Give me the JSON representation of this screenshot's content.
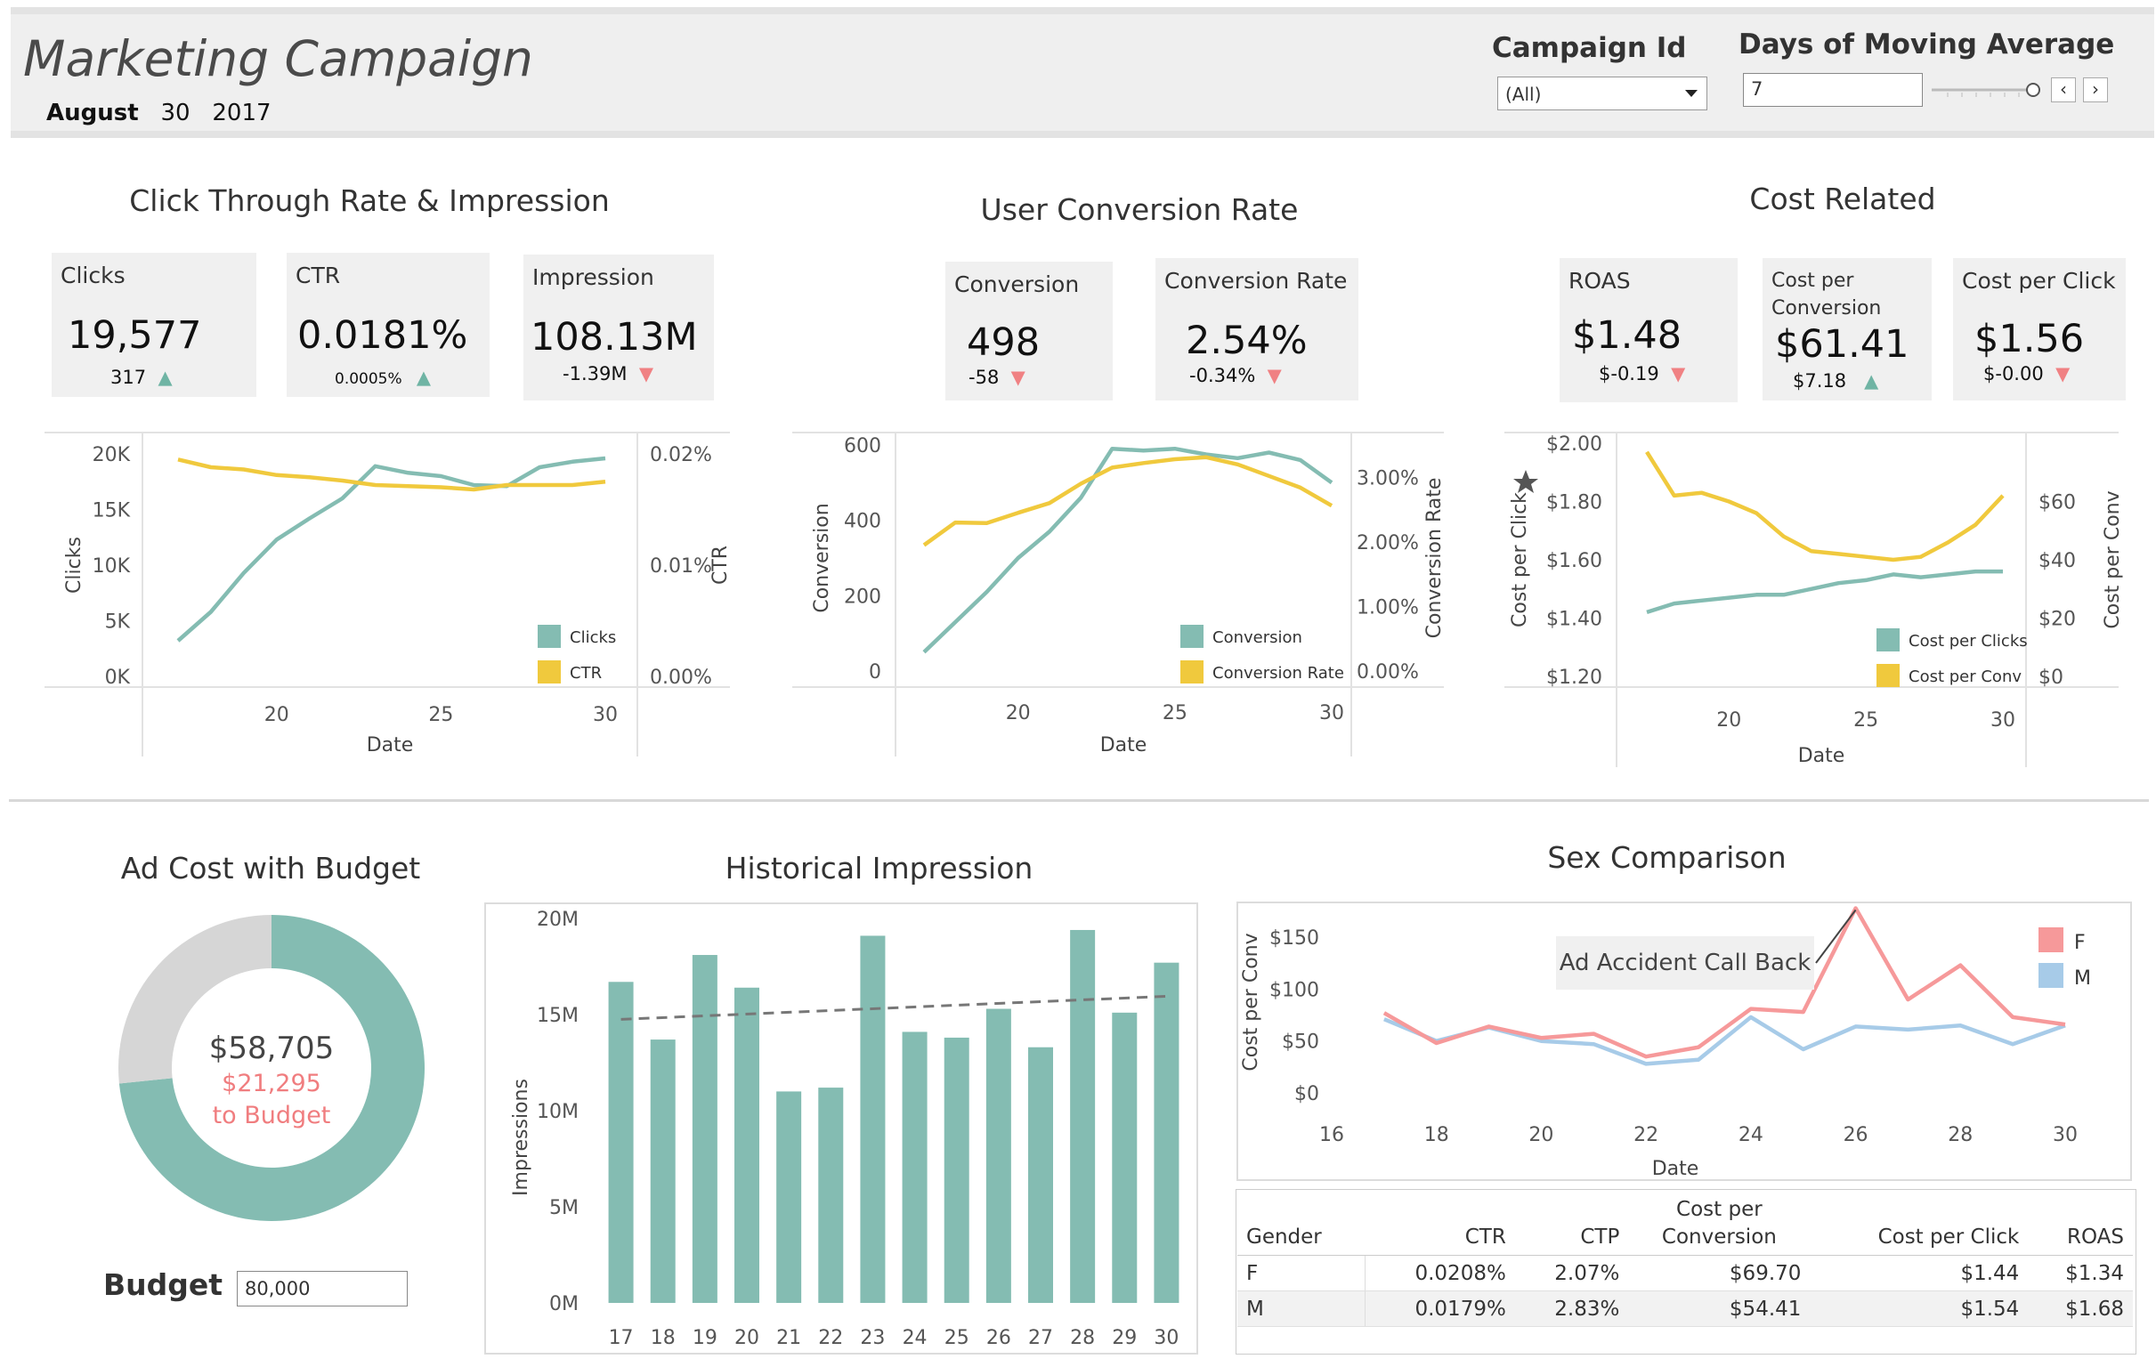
{
  "header": {
    "title": "Marketing Campaign",
    "date_month": "August",
    "date_day": "30",
    "date_year": "2017",
    "campaign_label": "Campaign Id",
    "campaign_value": "(All)",
    "days_label": "Days of Moving Average",
    "days_value": "7",
    "prev_glyph": "‹",
    "next_glyph": "›"
  },
  "colors": {
    "teal": "#84bcb2",
    "yellow": "#f0c93d",
    "pink": "#f6999a",
    "blue": "#a7cbe8",
    "up": "#6fb4a4",
    "down": "#f08183"
  },
  "sections": {
    "ctr": {
      "title": "Click Through Rate & Impression",
      "kpis": [
        {
          "label": "Clicks",
          "value": "19,577",
          "delta": "317",
          "dir": "up"
        },
        {
          "label": "CTR",
          "value": "0.0181%",
          "delta": "0.0005%",
          "dir": "up"
        },
        {
          "label": "Impression",
          "value": "108.13M",
          "delta": "-1.39M",
          "dir": "down"
        }
      ]
    },
    "conv": {
      "title": "User Conversion Rate",
      "kpis": [
        {
          "label": "Conversion",
          "value": "498",
          "delta": "-58",
          "dir": "down"
        },
        {
          "label": "Conversion Rate",
          "value": "2.54%",
          "delta": "-0.34%",
          "dir": "down"
        }
      ]
    },
    "cost": {
      "title": "Cost Related",
      "kpis": [
        {
          "label": "ROAS",
          "value": "$1.48",
          "delta": "$-0.19",
          "dir": "down"
        },
        {
          "label": "Cost per\nConversion",
          "value": "$61.41",
          "delta": "$7.18",
          "dir": "up"
        },
        {
          "label": "Cost per Click",
          "value": "$1.56",
          "delta": "$-0.00",
          "dir": "down"
        }
      ]
    },
    "budget": {
      "title": "Ad Cost with Budget",
      "spent": "$58,705",
      "remaining": "$21,295",
      "remaining_caption": "to Budget",
      "budget_label": "Budget",
      "budget_value": "80,000"
    },
    "historical": {
      "title": "Historical Impression"
    },
    "sex": {
      "title": "Sex Comparison",
      "annotation": "Ad Accident Call Back",
      "table": {
        "headers": [
          "Gender",
          "CTR",
          "CTP",
          "Cost per\nConversion",
          "Cost per Click",
          "ROAS"
        ],
        "rows": [
          [
            "F",
            "0.0208%",
            "2.07%",
            "$69.70",
            "$1.44",
            "$1.34"
          ],
          [
            "M",
            "0.0179%",
            "2.83%",
            "$54.41",
            "$1.54",
            "$1.68"
          ]
        ]
      }
    }
  },
  "chart_data": [
    {
      "id": "ctr_chart",
      "type": "line",
      "x": [
        17,
        18,
        19,
        20,
        21,
        22,
        23,
        24,
        25,
        26,
        27,
        28,
        29,
        30
      ],
      "xlabel": "Date",
      "x_ticks": [
        20,
        25,
        30
      ],
      "y_left": {
        "label": "Clicks",
        "ylim": [
          0,
          20000
        ],
        "ticks": [
          0,
          5000,
          10000,
          15000,
          20000
        ],
        "tick_labels": [
          "0K",
          "5K",
          "10K",
          "15K",
          "20K"
        ]
      },
      "y_right": {
        "label": "CTR",
        "ylim": [
          0,
          0.02
        ],
        "ticks": [
          0,
          0.01,
          0.02
        ],
        "tick_labels": [
          "0.00%",
          "0.01%",
          "0.02%"
        ]
      },
      "series": [
        {
          "name": "Clicks",
          "axis": "left",
          "color": "#84bcb2",
          "values": [
            3200,
            5800,
            9300,
            12300,
            14200,
            16000,
            18900,
            18300,
            18000,
            17200,
            17100,
            18800,
            19300,
            19600
          ]
        },
        {
          "name": "CTR",
          "axis": "right",
          "color": "#f0c93d",
          "values": [
            0.0195,
            0.0188,
            0.0186,
            0.0181,
            0.0179,
            0.0176,
            0.0172,
            0.0171,
            0.017,
            0.0168,
            0.0172,
            0.0172,
            0.0172,
            0.0175
          ]
        }
      ],
      "legend": "bottom-right"
    },
    {
      "id": "conv_chart",
      "type": "line",
      "x": [
        17,
        18,
        19,
        20,
        21,
        22,
        23,
        24,
        25,
        26,
        27,
        28,
        29,
        30
      ],
      "xlabel": "Date",
      "x_ticks": [
        20,
        25,
        30
      ],
      "y_left": {
        "label": "Conversion",
        "ylim": [
          0,
          600
        ],
        "ticks": [
          0,
          200,
          400,
          600
        ],
        "tick_labels": [
          "0",
          "200",
          "400",
          "600"
        ]
      },
      "y_right": {
        "label": "Conversion Rate",
        "ylim": [
          0,
          3.5
        ],
        "ticks": [
          0,
          1,
          2,
          3
        ],
        "tick_labels": [
          "0.00%",
          "1.00%",
          "2.00%",
          "3.00%"
        ]
      },
      "series": [
        {
          "name": "Conversion",
          "axis": "left",
          "color": "#84bcb2",
          "values": [
            50,
            130,
            210,
            300,
            370,
            460,
            590,
            585,
            590,
            575,
            565,
            580,
            560,
            500
          ]
        },
        {
          "name": "Conversion Rate",
          "axis": "right",
          "color": "#f0c93d",
          "values": [
            1.95,
            2.3,
            2.29,
            2.45,
            2.6,
            2.9,
            3.15,
            3.22,
            3.28,
            3.31,
            3.2,
            3.02,
            2.84,
            2.56
          ]
        }
      ],
      "legend": "bottom-right"
    },
    {
      "id": "cost_chart",
      "type": "line",
      "x": [
        17,
        18,
        19,
        20,
        21,
        22,
        23,
        24,
        25,
        26,
        27,
        28,
        29,
        30
      ],
      "xlabel": "Date",
      "x_ticks": [
        20,
        25,
        30
      ],
      "y_left": {
        "label": "Cost per Click",
        "ylim": [
          1.2,
          2.0
        ],
        "ticks": [
          1.2,
          1.4,
          1.6,
          1.8,
          2.0
        ],
        "tick_labels": [
          "$1.20",
          "$1.40",
          "$1.60",
          "$1.80",
          "$2.00"
        ]
      },
      "y_right": {
        "label": "Cost per Conv",
        "ylim": [
          0,
          80
        ],
        "ticks": [
          0,
          20,
          40,
          60
        ],
        "tick_labels": [
          "$0",
          "$20",
          "$40",
          "$60"
        ]
      },
      "series": [
        {
          "name": "Cost per Clicks",
          "axis": "left",
          "color": "#84bcb2",
          "values": [
            1.42,
            1.45,
            1.46,
            1.47,
            1.48,
            1.48,
            1.5,
            1.52,
            1.53,
            1.55,
            1.54,
            1.55,
            1.56,
            1.56
          ]
        },
        {
          "name": "Cost per Conv",
          "axis": "right",
          "color": "#f0c93d",
          "values": [
            77,
            62,
            63,
            60,
            56,
            48,
            43,
            42,
            41,
            40,
            41,
            46,
            52,
            62
          ]
        }
      ],
      "legend": "bottom-right"
    },
    {
      "id": "budget_donut",
      "type": "pie",
      "categories": [
        "Ad Cost",
        "Remaining to Budget"
      ],
      "values": [
        58705,
        21295
      ],
      "colors": [
        "#84bcb2",
        "#d6d6d6"
      ]
    },
    {
      "id": "historical_chart",
      "type": "bar",
      "categories": [
        "17",
        "18",
        "19",
        "20",
        "21",
        "22",
        "23",
        "24",
        "25",
        "26",
        "27",
        "28",
        "29",
        "30"
      ],
      "values": [
        16.7,
        13.7,
        18.1,
        16.4,
        11.0,
        11.2,
        19.1,
        14.1,
        13.8,
        15.3,
        13.3,
        19.4,
        15.1,
        17.7
      ],
      "trend": [
        14.75,
        15.95
      ],
      "ylabel": "Impressions",
      "ylim": [
        0,
        20
      ],
      "y_ticks": [
        0,
        5,
        10,
        15,
        20
      ],
      "y_tick_labels": [
        "0M",
        "5M",
        "10M",
        "15M",
        "20M"
      ],
      "color": "#84bcb2"
    },
    {
      "id": "sex_chart",
      "type": "line",
      "x": [
        17,
        18,
        19,
        20,
        21,
        22,
        23,
        24,
        25,
        26,
        27,
        28,
        29,
        30
      ],
      "xlabel": "Date",
      "x_ticks": [
        16,
        18,
        20,
        22,
        24,
        26,
        28,
        30
      ],
      "ylabel": "Cost per Conv",
      "ylim": [
        0,
        175
      ],
      "y_ticks": [
        0,
        50,
        100,
        150
      ],
      "y_tick_labels": [
        "$0",
        "$50",
        "$100",
        "$150"
      ],
      "series": [
        {
          "name": "F",
          "color": "#f6999a",
          "values": [
            77,
            48,
            64,
            53,
            57,
            35,
            44,
            81,
            78,
            178,
            90,
            123,
            73,
            66
          ]
        },
        {
          "name": "M",
          "color": "#a7cbe8",
          "values": [
            71,
            50,
            63,
            50,
            47,
            28,
            32,
            73,
            42,
            64,
            61,
            65,
            47,
            65
          ]
        }
      ],
      "legend": "top-right"
    }
  ]
}
